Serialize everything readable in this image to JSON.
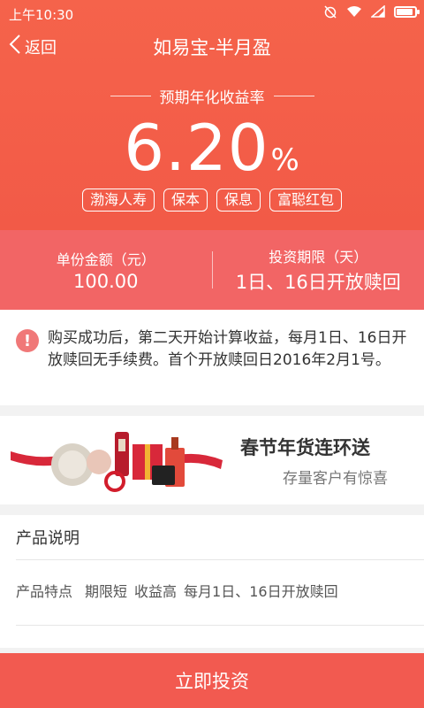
{
  "status": {
    "time": "上午10:30"
  },
  "nav": {
    "back_label": "返回",
    "title": "如易宝-半月盈"
  },
  "rate": {
    "label": "预期年化收益率",
    "value": "6.20",
    "unit": "%"
  },
  "tags": [
    "渤海人寿",
    "保本",
    "保息",
    "富聪红包"
  ],
  "info": {
    "unit_amount_label": "单份金额（元）",
    "unit_amount_value": "100.00",
    "period_label": "投资期限（天）",
    "period_value": "1日、16日开放赎回"
  },
  "notice": {
    "icon": "exclamation-icon",
    "text": "购买成功后，第二天开始计算收益，每月1日、16日开放赎回无手续费。首个开放赎回日2016年2月1号。"
  },
  "banner": {
    "title": "春节年货连环送",
    "subtitle": "存量客户有惊喜"
  },
  "description": {
    "title": "产品说明",
    "feature_label": "产品特点",
    "feature_items": [
      "期限短",
      "收益高",
      "每月1日、16日开放赎回"
    ]
  },
  "action": {
    "invest_label": "立即投资"
  },
  "colors": {
    "primary": "#f25a47",
    "band": "#f26565",
    "button": "#f25a50"
  }
}
